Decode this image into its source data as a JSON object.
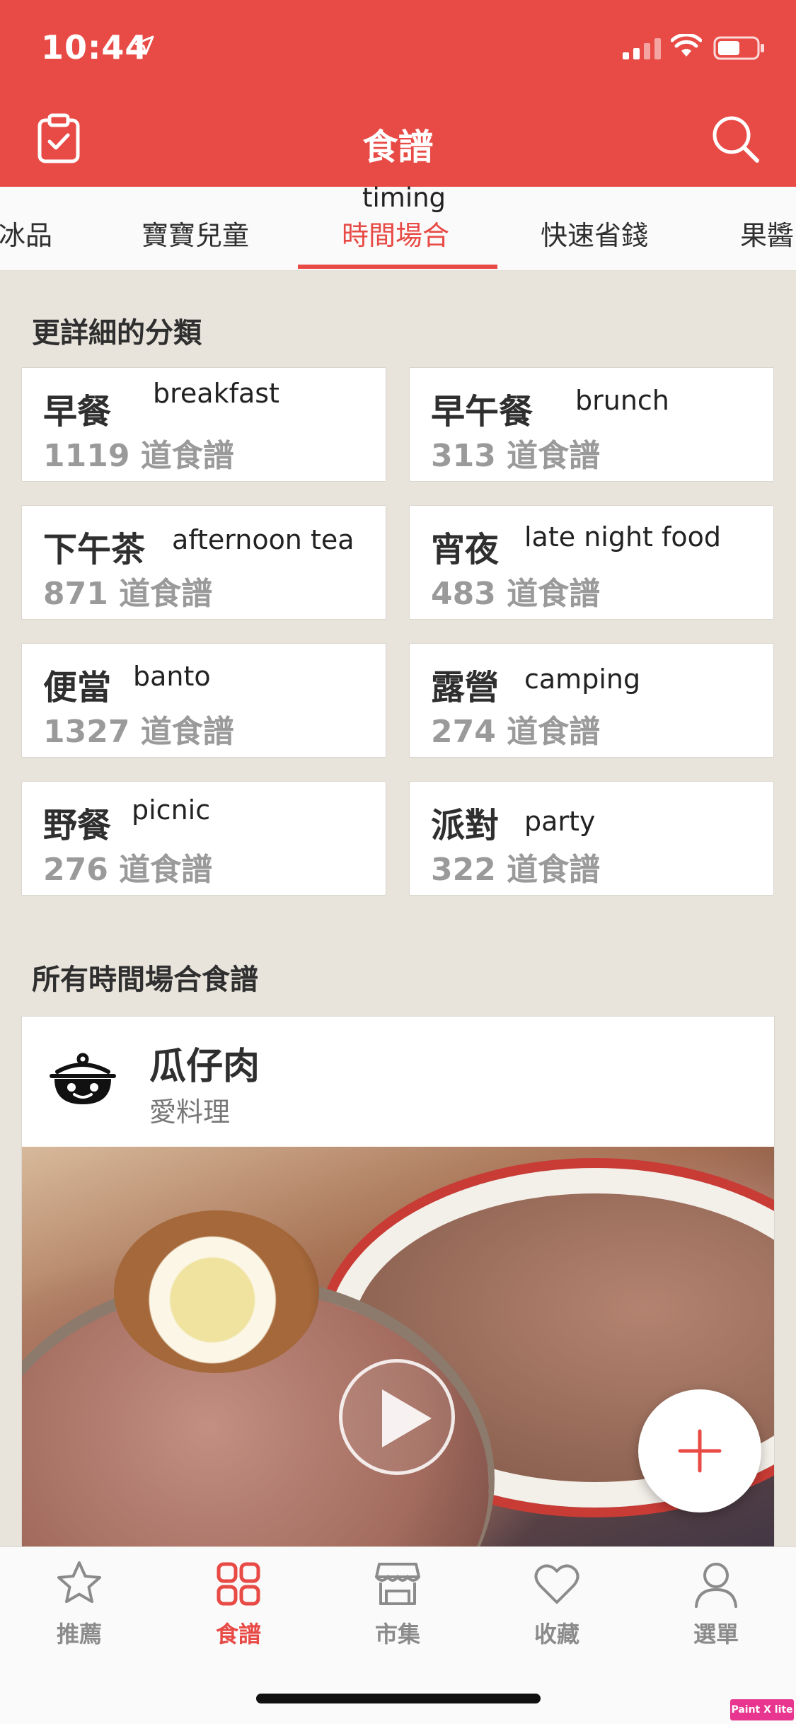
{
  "status_bar": {
    "time": "10:44"
  },
  "header": {
    "title": "食譜"
  },
  "category_tabs": {
    "items": [
      "冰品",
      "寶寶兒童",
      "時間場合",
      "快速省錢",
      "果醬"
    ],
    "active_index": 2,
    "active_annotation": "timing"
  },
  "subcategories": {
    "title": "更詳細的分類",
    "items": [
      {
        "name": "早餐",
        "note": "breakfast",
        "count": "1119 道食譜"
      },
      {
        "name": "早午餐",
        "note": "brunch",
        "count": "313 道食譜"
      },
      {
        "name": "下午茶",
        "note": "afternoon tea",
        "count": "871 道食譜"
      },
      {
        "name": "宵夜",
        "note": "late night food",
        "count": "483 道食譜"
      },
      {
        "name": "便當",
        "note": "banto",
        "count": "1327 道食譜"
      },
      {
        "name": "露營",
        "note": "camping",
        "count": "274 道食譜"
      },
      {
        "name": "野餐",
        "note": "picnic",
        "count": "276 道食譜"
      },
      {
        "name": "派對",
        "note": "party",
        "count": "322 道食譜"
      }
    ]
  },
  "all_recipes": {
    "title": "所有時間場合食譜",
    "recipe": {
      "name": "瓜仔肉",
      "author": "愛料理",
      "has_video": true
    }
  },
  "fab": {
    "icon": "plus-icon"
  },
  "bottom_nav": {
    "items": [
      {
        "label": "推薦",
        "icon": "star-icon"
      },
      {
        "label": "食譜",
        "icon": "grid-icon"
      },
      {
        "label": "市集",
        "icon": "store-icon"
      },
      {
        "label": "收藏",
        "icon": "heart-icon"
      },
      {
        "label": "選單",
        "icon": "user-icon"
      }
    ],
    "active_index": 1
  },
  "watermark": "Paint X lite",
  "colors": {
    "brand": "#e84a45",
    "background": "#e8e4dc",
    "muted_text": "#9a9a9a"
  }
}
